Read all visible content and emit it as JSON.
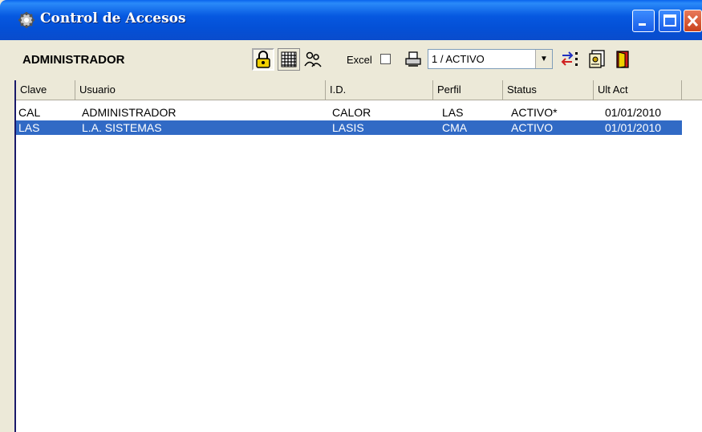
{
  "window": {
    "title": "Control de Accesos"
  },
  "toolbar": {
    "user_label": "ADMINISTRADOR",
    "excel_label": "Excel",
    "excel_checked": false,
    "status_combo_value": "1 / ACTIVO",
    "icons": [
      "lock-icon",
      "grid-icon",
      "users-icon",
      "printer-icon",
      "sort-icon",
      "document-icon",
      "exit-door-icon"
    ]
  },
  "columns": [
    "Clave",
    "Usuario",
    "I.D.",
    "Perfil",
    "Status",
    "Ult Act"
  ],
  "rows": [
    {
      "clave": "CAL",
      "usuario": "ADMINISTRADOR",
      "id": "CALOR",
      "perfil": "LAS",
      "status": "ACTIVO*",
      "ult_act": "01/01/2010",
      "selected": false
    },
    {
      "clave": "LAS",
      "usuario": "L.A. SISTEMAS",
      "id": "LASIS",
      "perfil": "CMA",
      "status": "ACTIVO",
      "ult_act": "01/01/2010",
      "selected": true
    }
  ],
  "colors": {
    "title_bar": "#0a56e0",
    "selection": "#316ac5",
    "window_face": "#ece9d8"
  }
}
